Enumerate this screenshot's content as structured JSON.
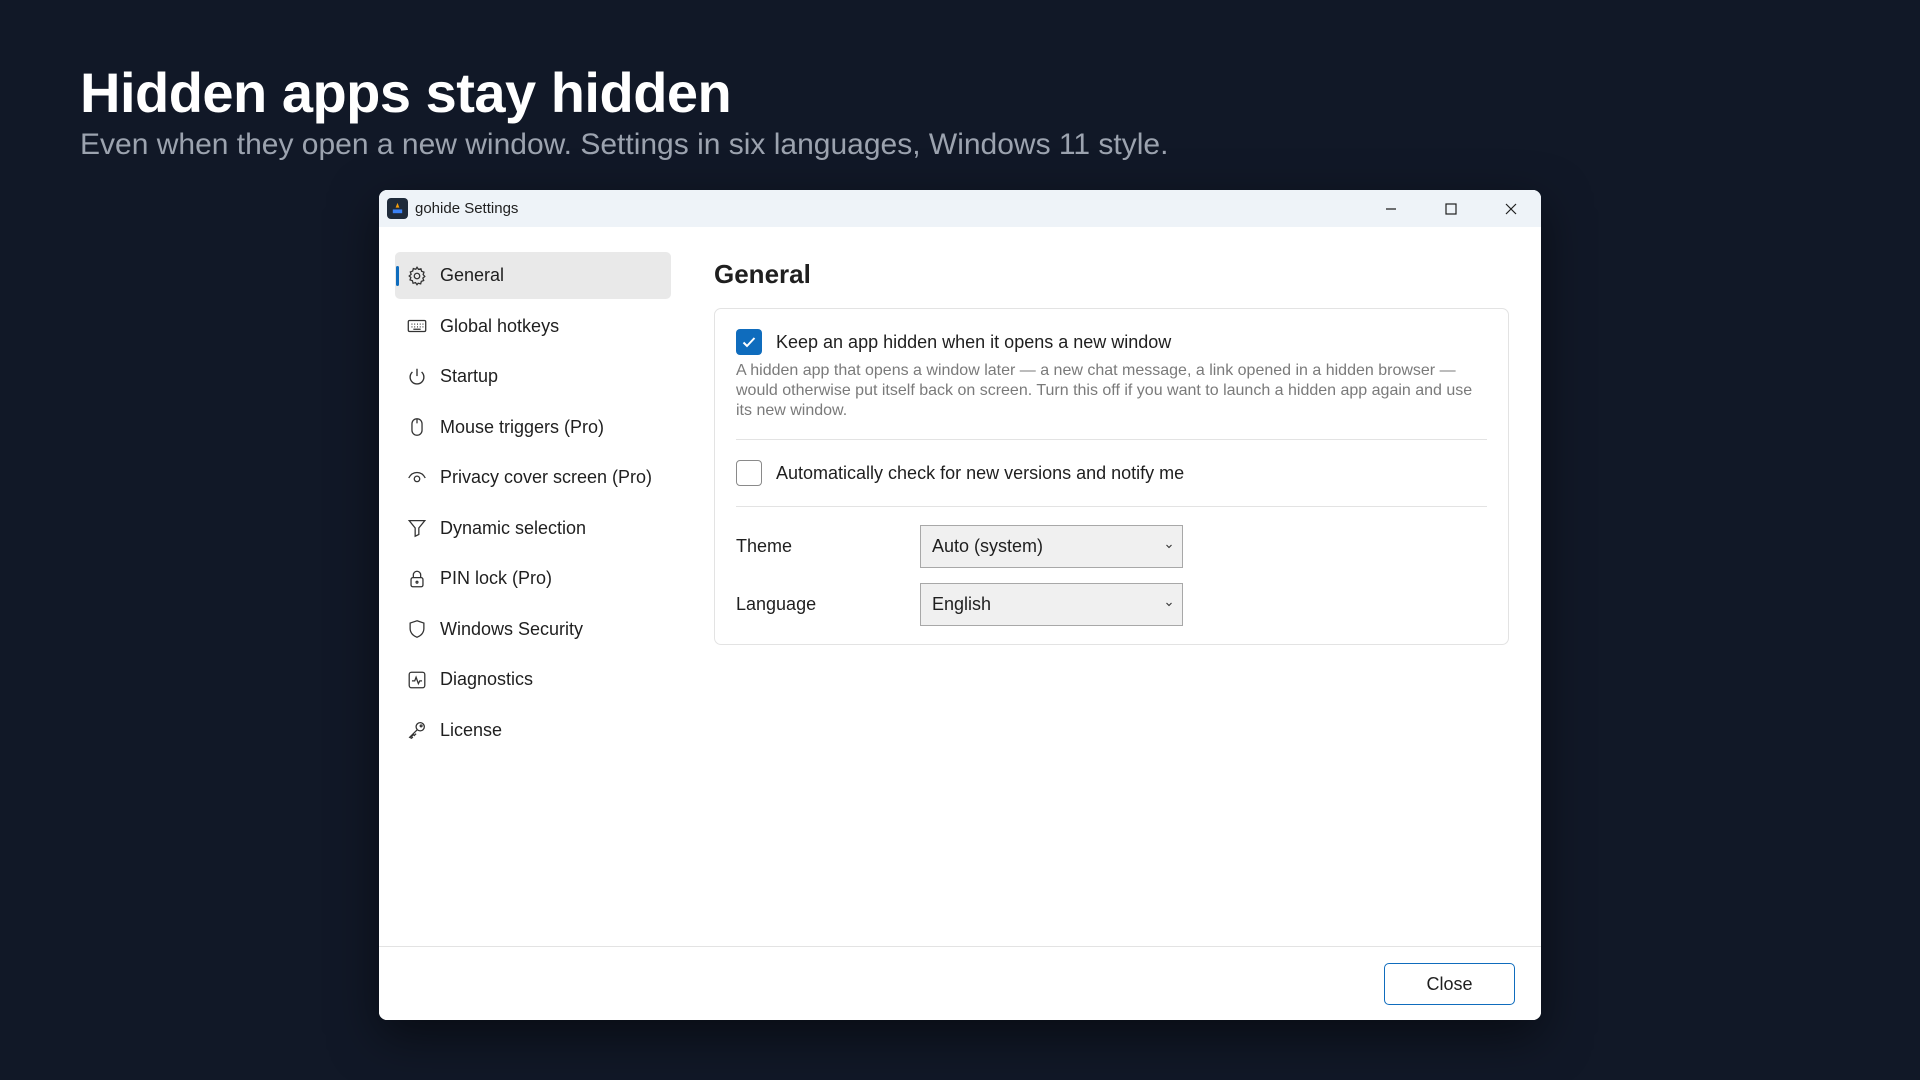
{
  "hero": {
    "title": "Hidden apps stay hidden",
    "subtitle": "Even when they open a new window. Settings in six languages, Windows 11 style."
  },
  "window": {
    "title": "gohide Settings",
    "caption_buttons": [
      "minimize-icon",
      "maximize-icon",
      "close-icon"
    ]
  },
  "sidebar": {
    "active_index": 0,
    "accent_color": "#0f6cbd",
    "items": [
      {
        "label": "General",
        "icon": "gear-icon"
      },
      {
        "label": "Global hotkeys",
        "icon": "keyboard-icon"
      },
      {
        "label": "Startup",
        "icon": "power-icon"
      },
      {
        "label": "Mouse triggers (Pro)",
        "icon": "mouse-icon"
      },
      {
        "label": "Privacy cover screen (Pro)",
        "icon": "eye-icon"
      },
      {
        "label": "Dynamic selection",
        "icon": "filter-icon"
      },
      {
        "label": "PIN lock (Pro)",
        "icon": "lock-icon"
      },
      {
        "label": "Windows Security",
        "icon": "shield-icon"
      },
      {
        "label": "Diagnostics",
        "icon": "pulse-icon"
      },
      {
        "label": "License",
        "icon": "key-icon"
      }
    ]
  },
  "content": {
    "title": "General",
    "keep_hidden": {
      "checked": true,
      "label": "Keep an app hidden when it opens a new window",
      "description": "A hidden app that opens a window later — a new chat message, a link opened in a hidden browser — would otherwise put itself back on screen. Turn this off if you want to launch a hidden app again and use its new window."
    },
    "auto_update": {
      "checked": false,
      "label": "Automatically check for new versions and notify me"
    },
    "theme": {
      "label": "Theme",
      "value": "Auto (system)"
    },
    "language": {
      "label": "Language",
      "value": "English"
    }
  },
  "footer": {
    "close_label": "Close"
  }
}
